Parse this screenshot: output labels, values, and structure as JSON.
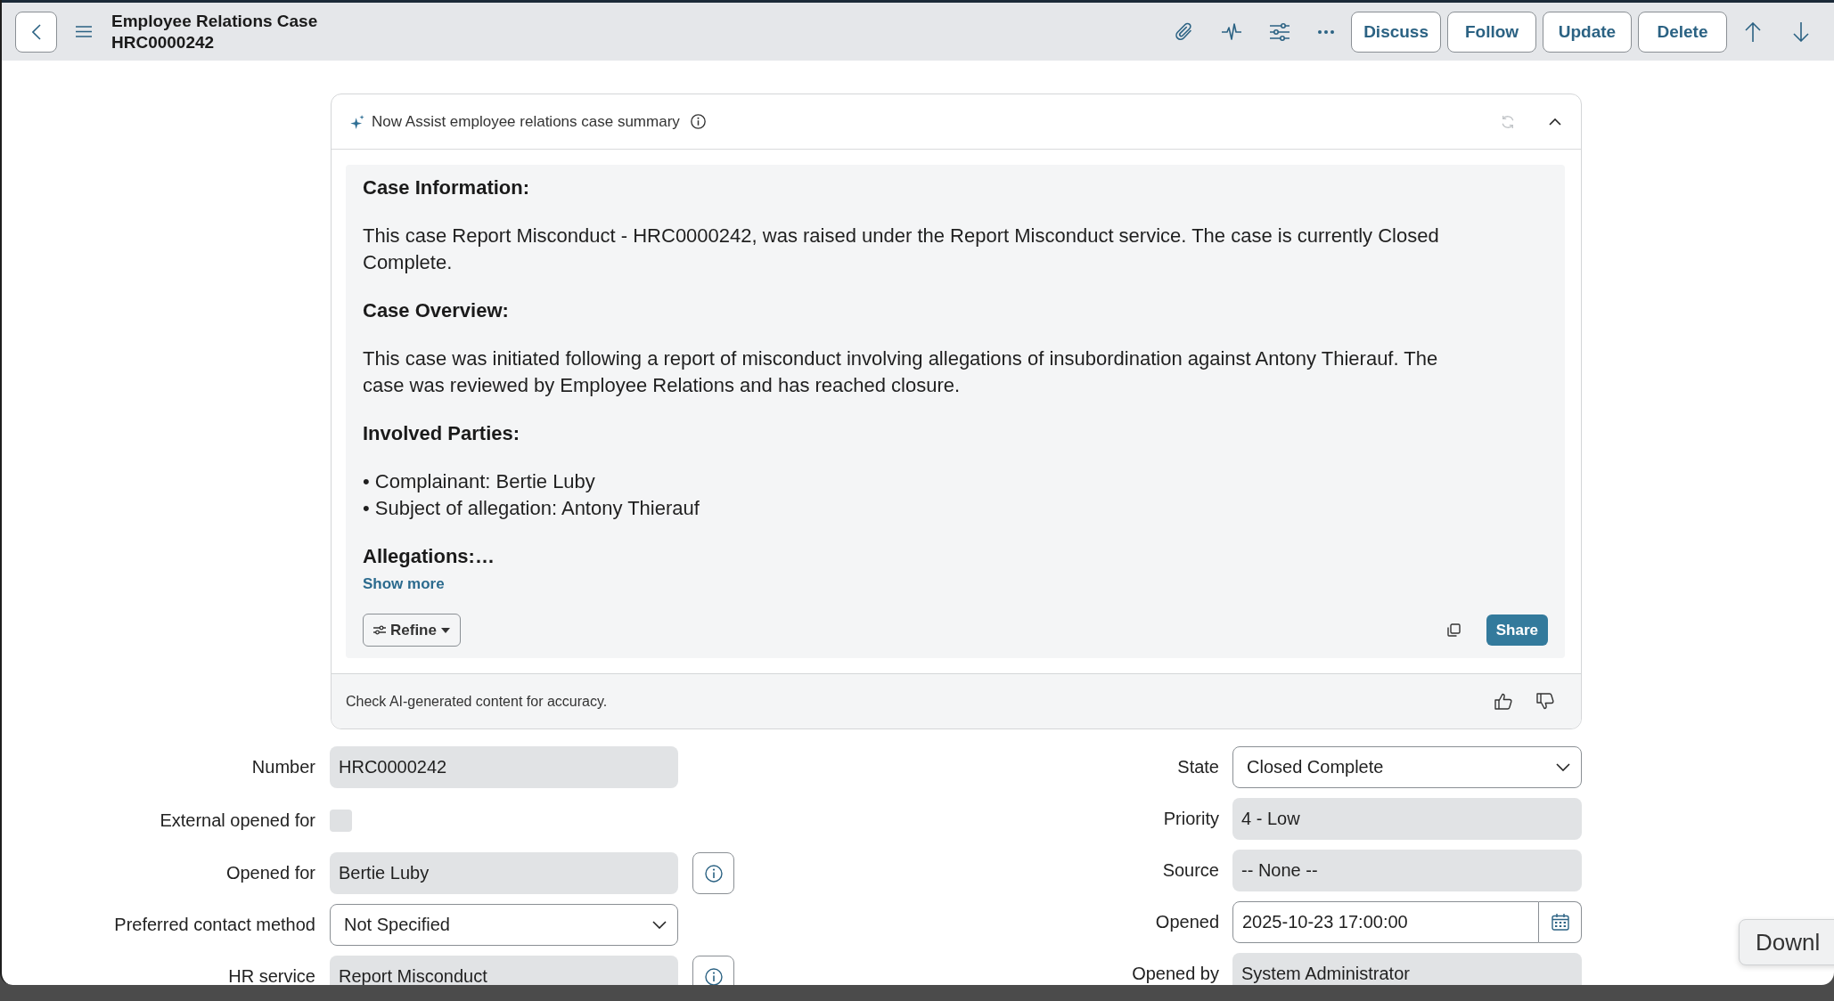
{
  "header": {
    "title": "Employee Relations Case",
    "subtitle": "HRC0000242",
    "buttons": [
      "Discuss",
      "Follow",
      "Update",
      "Delete"
    ]
  },
  "summary": {
    "title": "Now Assist employee relations case summary",
    "expanded": true,
    "sections": [
      {
        "kind": "paragraph",
        "heading": "Case Information:",
        "text": "This case Report Misconduct - HRC0000242, was raised under the Report Misconduct service. The case is currently Closed Complete."
      },
      {
        "kind": "paragraph",
        "heading": "Case Overview:",
        "text": "This case was initiated following a report of misconduct involving allegations of insubordination against Antony Thierauf. The case was reviewed by Employee Relations and has reached closure."
      },
      {
        "kind": "list",
        "heading": "Involved Parties:",
        "items": [
          "• Complainant: Bertie Luby",
          "• Subject of allegation: Antony Thierauf"
        ]
      },
      {
        "kind": "heading",
        "heading": "Allegations:…"
      }
    ],
    "show_more": "Show more",
    "refine": "Refine",
    "share": "Share",
    "disclaimer": "Check AI-generated content for accuracy."
  },
  "form": {
    "left": [
      {
        "label": "Number",
        "kind": "readonly",
        "value": "HRC0000242"
      },
      {
        "label": "External opened for",
        "kind": "checkbox",
        "checked": false
      },
      {
        "label": "Opened for",
        "kind": "reference",
        "value": "Bertie Luby"
      },
      {
        "label": "Preferred contact method",
        "kind": "select",
        "value": "Not Specified"
      },
      {
        "label": "HR service",
        "kind": "reference",
        "value": "Report Misconduct"
      }
    ],
    "right": [
      {
        "label": "State",
        "kind": "select",
        "value": "Closed Complete"
      },
      {
        "label": "Priority",
        "kind": "readonly",
        "value": "4 - Low"
      },
      {
        "label": "Source",
        "kind": "readonly",
        "value": "-- None --"
      },
      {
        "label": "Opened",
        "kind": "datetime",
        "value": "2025-10-23 17:00:00"
      },
      {
        "label": "Opened by",
        "kind": "readonly",
        "value": "System Administrator"
      }
    ]
  },
  "tooltip": {
    "text": "Downl"
  }
}
